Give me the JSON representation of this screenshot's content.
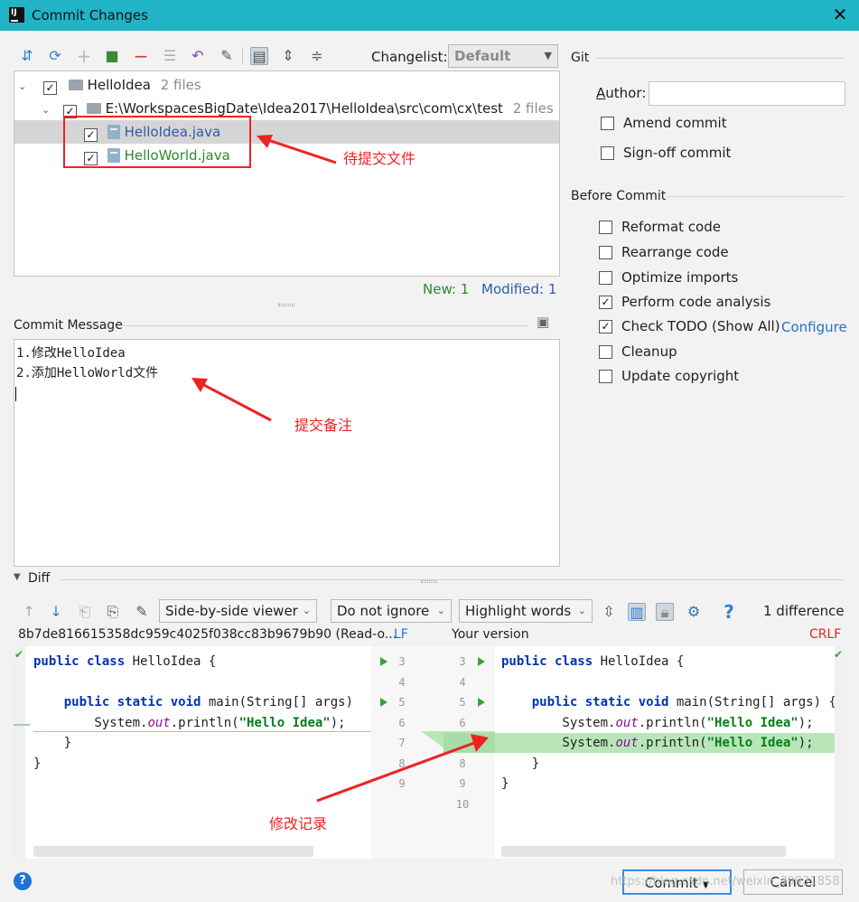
{
  "window": {
    "title": "Commit Changes",
    "close": "✕"
  },
  "toolbar": {
    "changelist_label": "Changelist:",
    "changelist_value": "Default"
  },
  "tree": {
    "root": {
      "name": "HelloIdea",
      "count": "2 files"
    },
    "folder": {
      "path": "E:\\WorkspacesBigDate\\Idea2017\\HelloIdea\\src\\com\\cx\\test",
      "count": "2 files"
    },
    "files": [
      {
        "name": "HelloIdea.java",
        "status": "modified"
      },
      {
        "name": "HelloWorld.java",
        "status": "new"
      }
    ],
    "summary_new": "New: 1",
    "summary_modified": "Modified: 1"
  },
  "annotations": {
    "files": "待提交文件",
    "message": "提交备注",
    "diff": "修改记录"
  },
  "commit_message": {
    "label": "Commit Message",
    "lines": [
      "1.修改HelloIdea",
      "2.添加HelloWorld文件"
    ]
  },
  "git": {
    "title": "Git",
    "author_label": "Author:",
    "author_value": "",
    "amend": "Amend commit",
    "signoff": "Sign-off commit"
  },
  "before_commit": {
    "title": "Before Commit",
    "options": [
      {
        "label": "Reformat code",
        "checked": false
      },
      {
        "label": "Rearrange code",
        "checked": false
      },
      {
        "label": "Optimize imports",
        "checked": false
      },
      {
        "label": "Perform code analysis",
        "checked": true
      },
      {
        "label": "Check TODO (Show All)",
        "checked": true
      },
      {
        "label": "Cleanup",
        "checked": false
      },
      {
        "label": "Update copyright",
        "checked": false
      }
    ],
    "configure_link": "Configure"
  },
  "diff": {
    "label": "Diff",
    "viewer": "Side-by-side viewer",
    "ignore": "Do not ignore",
    "highlight": "Highlight words",
    "count": "1 difference",
    "left_header": "8b7de816615358dc959c4025f038cc83b9679b90 (Read-o...",
    "left_lf": "LF",
    "right_header": "Your version",
    "right_crlf": "CRLF",
    "left_numbers": [
      "3",
      "4",
      "5",
      "6",
      "7",
      "8",
      "9"
    ],
    "right_numbers": [
      "3",
      "4",
      "5",
      "6",
      "7",
      "8",
      "9",
      "10"
    ]
  },
  "buttons": {
    "commit": "Commit",
    "cancel": "Cancel",
    "help": "?"
  },
  "watermark": "https://blog.csdn.net/weixin_39931858"
}
